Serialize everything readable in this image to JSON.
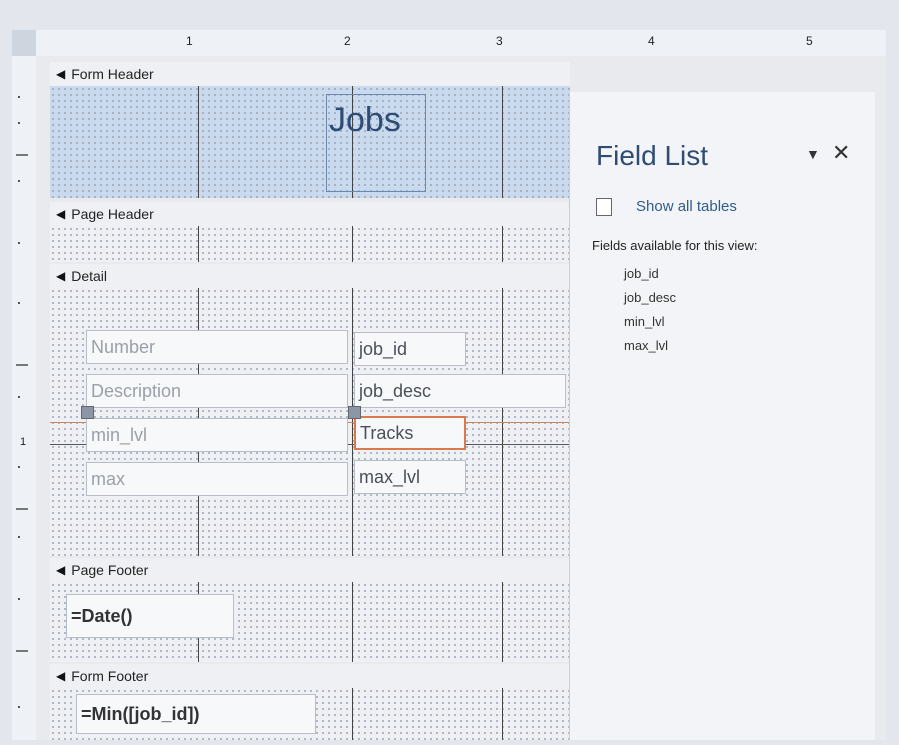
{
  "ruler": {
    "h": [
      "1",
      "2",
      "3",
      "4",
      "5"
    ],
    "v": [
      "1"
    ]
  },
  "sections": {
    "form_header": "Form Header",
    "page_header": "Page Header",
    "detail": "Detail",
    "page_footer": "Page Footer",
    "form_footer": "Form Footer"
  },
  "form": {
    "title": "Jobs",
    "labels": [
      "Number",
      "Description",
      "min_lvl",
      "max"
    ],
    "fields": [
      "job_id",
      "job_desc",
      "Tracks",
      "max_lvl"
    ],
    "page_footer_expr": "=Date()",
    "form_footer_expr": "=Min([job_id])"
  },
  "field_list": {
    "title": "Field List",
    "dropdown_icon": "chevron-down-icon",
    "close_icon": "close-icon",
    "show_all": "Show all tables",
    "available": "Fields available for this view:",
    "fields": [
      "job_id",
      "job_desc",
      "min_lvl",
      "max_lvl"
    ]
  },
  "colors": {
    "selected_border": "#d77a4e",
    "header_tint": "#c9d9ee",
    "title_color": "#2f4d74"
  }
}
